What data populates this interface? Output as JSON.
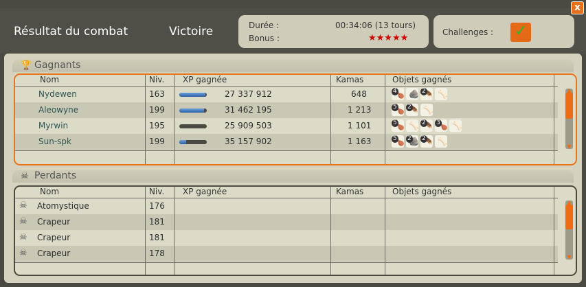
{
  "window": {
    "title": "Résultat du combat",
    "result": "Victoire",
    "close_label": "x"
  },
  "info": {
    "duration_label": "Durée :",
    "duration_value": "00:34:06 (13 tours)",
    "bonus_label": "Bonus :",
    "bonus_stars": "★★★★★",
    "challenges_label": "Challenges :"
  },
  "winners": {
    "title": "Gagnants",
    "icon": "trophy-icon",
    "headers": {
      "name": "Nom",
      "level": "Niv.",
      "xp": "XP gagnée",
      "kamas": "Kamas",
      "items": "Objets gagnés"
    },
    "rows": [
      {
        "name": "Nydewen",
        "level": "163",
        "xp": "27 337 912",
        "xp_fill": 0.95,
        "kamas": "648",
        "items": [
          {
            "qty": "4"
          },
          {
            "qty": ""
          },
          {
            "qty": "2"
          },
          {
            "qty": ""
          }
        ]
      },
      {
        "name": "Aleowyne",
        "level": "199",
        "xp": "31 462 195",
        "xp_fill": 0.9,
        "kamas": "1 213",
        "items": [
          {
            "qty": "5"
          },
          {
            "qty": "2"
          },
          {
            "qty": ""
          }
        ]
      },
      {
        "name": "Myrwin",
        "level": "195",
        "xp": "25 909 503",
        "xp_fill": 0.0,
        "kamas": "1 101",
        "items": [
          {
            "qty": "5"
          },
          {
            "qty": ""
          },
          {
            "qty": "2"
          },
          {
            "qty": "3"
          },
          {
            "qty": ""
          }
        ]
      },
      {
        "name": "Sun-spk",
        "level": "199",
        "xp": "35 157 902",
        "xp_fill": 0.25,
        "kamas": "1 163",
        "items": [
          {
            "qty": "5"
          },
          {
            "qty": "2"
          },
          {
            "qty": "2"
          },
          {
            "qty": ""
          }
        ]
      }
    ]
  },
  "losers": {
    "title": "Perdants",
    "icon": "skull-icon",
    "headers": {
      "name": "Nom",
      "level": "Niv.",
      "xp": "XP gagnée",
      "kamas": "Kamas",
      "items": "Objets gagnés"
    },
    "rows": [
      {
        "name": "Atomystique",
        "level": "176"
      },
      {
        "name": "Crapeur",
        "level": "181"
      },
      {
        "name": "Crapeur",
        "level": "181"
      },
      {
        "name": "Crapeur",
        "level": "178"
      }
    ]
  }
}
